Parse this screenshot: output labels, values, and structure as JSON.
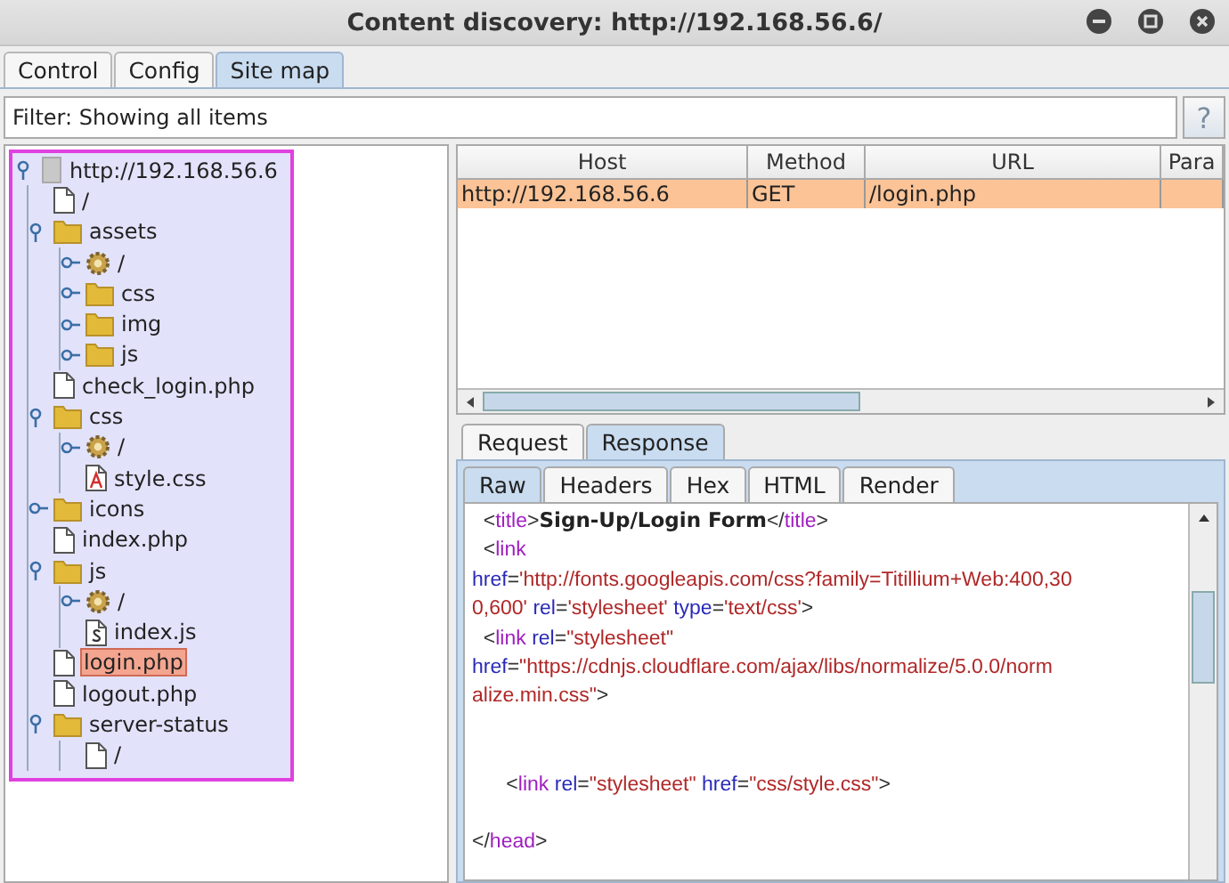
{
  "window": {
    "title": "Content discovery: http://192.168.56.6/"
  },
  "tabs": [
    {
      "label": "Control",
      "selected": false
    },
    {
      "label": "Config",
      "selected": false
    },
    {
      "label": "Site map",
      "selected": true
    }
  ],
  "filter": {
    "value": "Filter: Showing all items",
    "help": "?"
  },
  "tree": [
    {
      "kind": "host",
      "label": "http://192.168.56.6",
      "expanded": true,
      "selected": false,
      "children": [
        {
          "kind": "file",
          "label": "/",
          "selected": false
        },
        {
          "kind": "folder",
          "label": "assets",
          "expanded": true,
          "selected": false,
          "children": [
            {
              "kind": "gear",
              "label": "/",
              "expanded": false,
              "selected": false
            },
            {
              "kind": "folder",
              "label": "css",
              "expanded": false,
              "selected": false
            },
            {
              "kind": "folder",
              "label": "img",
              "expanded": false,
              "selected": false
            },
            {
              "kind": "folder",
              "label": "js",
              "expanded": false,
              "selected": false
            }
          ]
        },
        {
          "kind": "file",
          "label": "check_login.php",
          "selected": false
        },
        {
          "kind": "folder",
          "label": "css",
          "expanded": true,
          "selected": false,
          "children": [
            {
              "kind": "gear",
              "label": "/",
              "expanded": false,
              "selected": false
            },
            {
              "kind": "css",
              "label": "style.css",
              "selected": false
            }
          ]
        },
        {
          "kind": "folder",
          "label": "icons",
          "expanded": false,
          "selected": false
        },
        {
          "kind": "file",
          "label": "index.php",
          "selected": false
        },
        {
          "kind": "folder",
          "label": "js",
          "expanded": true,
          "selected": false,
          "children": [
            {
              "kind": "gear",
              "label": "/",
              "expanded": false,
              "selected": false
            },
            {
              "kind": "script",
              "label": "index.js",
              "selected": false
            }
          ]
        },
        {
          "kind": "file",
          "label": "login.php",
          "selected": true
        },
        {
          "kind": "file",
          "label": "logout.php",
          "selected": false
        },
        {
          "kind": "folder",
          "label": "server-status",
          "expanded": true,
          "selected": false,
          "children": [
            {
              "kind": "file",
              "label": "/",
              "selected": false
            }
          ]
        }
      ]
    }
  ],
  "table": {
    "columns": [
      "Host",
      "Method",
      "URL",
      "Para"
    ],
    "rows": [
      {
        "cells": [
          "http://192.168.56.6",
          "GET",
          "/login.php",
          ""
        ],
        "selected": true
      }
    ]
  },
  "message_tabs": [
    {
      "label": "Request",
      "selected": false
    },
    {
      "label": "Response",
      "selected": true
    }
  ],
  "view_tabs": [
    {
      "label": "Raw",
      "selected": true
    },
    {
      "label": "Headers",
      "selected": false
    },
    {
      "label": "Hex",
      "selected": false
    },
    {
      "label": "HTML",
      "selected": false
    },
    {
      "label": "Render",
      "selected": false
    }
  ],
  "response_body": "  <title>Sign-Up/Login Form</title>\n  <link\nhref='http://fonts.googleapis.com/css?family=Titillium+Web:400,30\n0,600' rel='stylesheet' type='text/css'>\n  <link rel=\"stylesheet\"\nhref=\"https://cdnjs.cloudflare.com/ajax/libs/normalize/5.0.0/norm\nalize.min.css\">\n\n\n      <link rel=\"stylesheet\" href=\"css/style.css\">\n\n</head>"
}
